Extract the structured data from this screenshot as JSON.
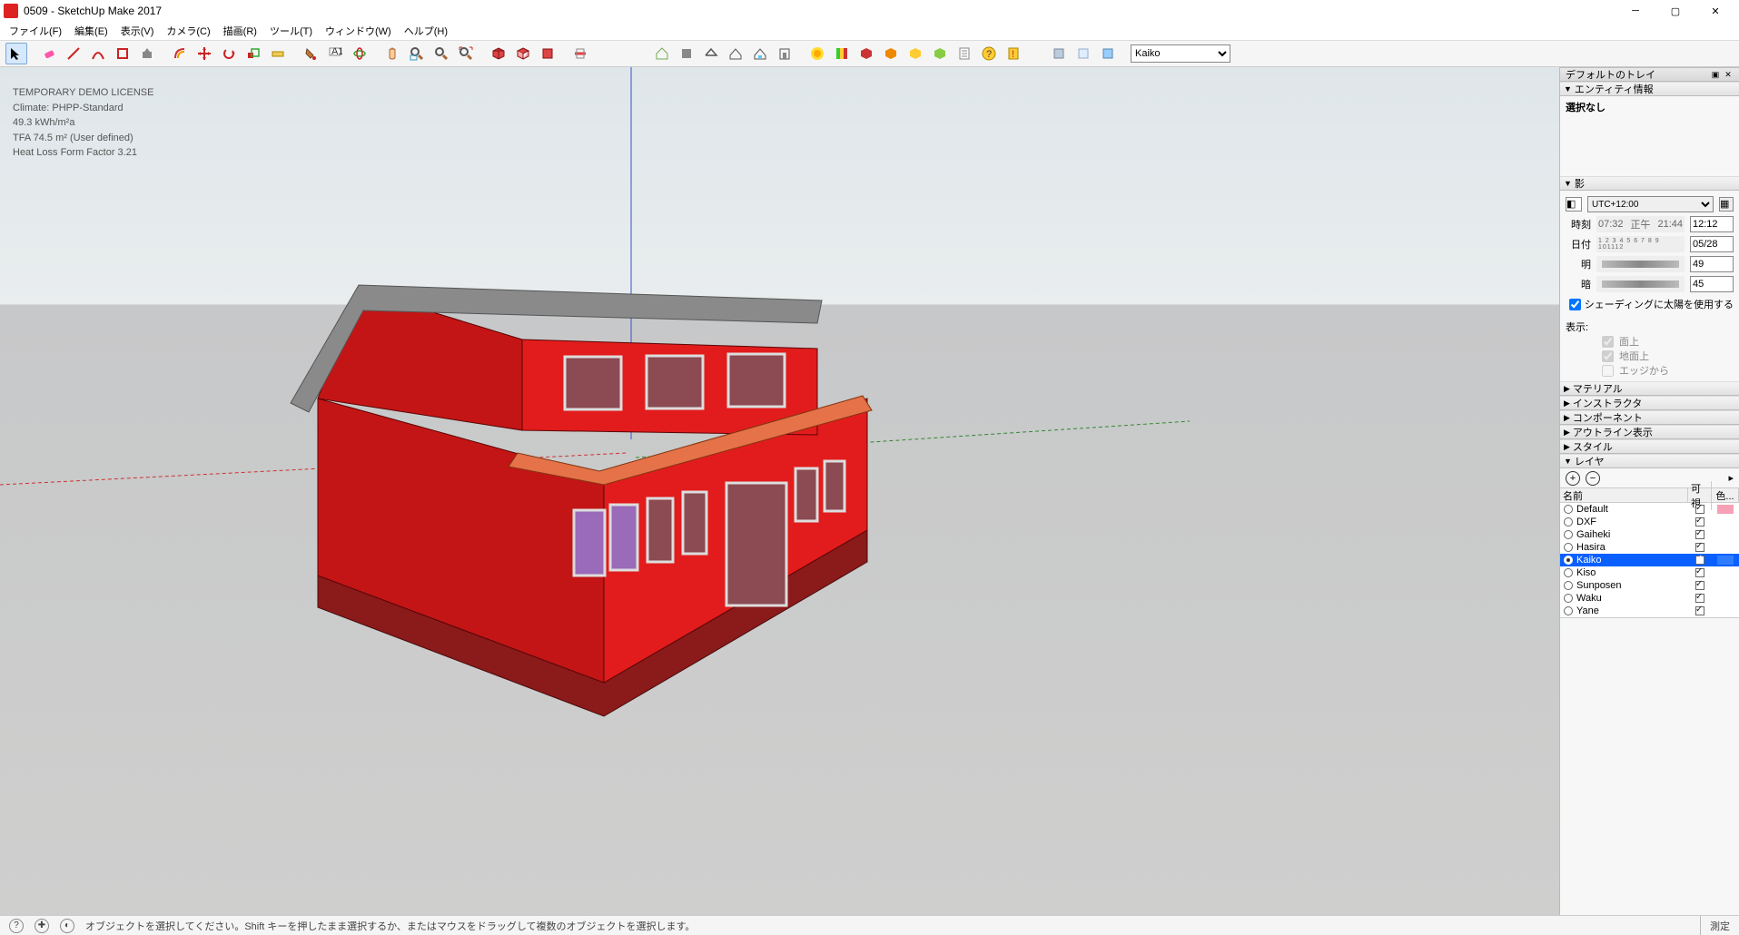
{
  "window": {
    "title": "0509 - SketchUp Make 2017"
  },
  "menu": [
    "ファイル(F)",
    "編集(E)",
    "表示(V)",
    "カメラ(C)",
    "描画(R)",
    "ツール(T)",
    "ウィンドウ(W)",
    "ヘルプ(H)"
  ],
  "scene_select": {
    "value": "Kaiko"
  },
  "overlay": {
    "line1": "TEMPORARY DEMO LICENSE",
    "line2": "Climate: PHPP-Standard",
    "line3": "49.3 kWh/m²a",
    "line4": "TFA  74.5 m² (User defined)",
    "line5": "Heat Loss Form Factor 3.21"
  },
  "tray": {
    "title": "デフォルトのトレイ",
    "entity": {
      "header": "エンティティ情報",
      "text": "選択なし"
    },
    "shadow": {
      "header": "影",
      "tz": "UTC+12:00",
      "time_label": "時刻",
      "time_start": "07:32",
      "time_mid": "正午",
      "time_end": "21:44",
      "time_value": "12:12",
      "date_label": "日付",
      "date_ticks": "1 2 3 4 5 6 7 8 9 101112",
      "date_value": "05/28",
      "light_label": "明",
      "light_value": "49",
      "dark_label": "暗",
      "dark_value": "45",
      "use_sun": "シェーディングに太陽を使用する",
      "display_label": "表示:",
      "opt_face": "面上",
      "opt_ground": "地面上",
      "opt_edge": "エッジから"
    },
    "collapsed": [
      "マテリアル",
      "インストラクタ",
      "コンポーネント",
      "アウトライン表示",
      "スタイル"
    ],
    "layers": {
      "header": "レイヤ",
      "cols": {
        "name": "名前",
        "vis": "可視",
        "color": "色..."
      },
      "items": [
        {
          "name": "Default",
          "vis": true,
          "active": false,
          "color": "#f7a0b6"
        },
        {
          "name": "DXF",
          "vis": true,
          "active": false,
          "color": ""
        },
        {
          "name": "Gaiheki",
          "vis": true,
          "active": false,
          "color": ""
        },
        {
          "name": "Hasira",
          "vis": true,
          "active": false,
          "color": ""
        },
        {
          "name": "Kaiko",
          "vis": true,
          "active": true,
          "color": "#2f7cff",
          "selected": true
        },
        {
          "name": "Kiso",
          "vis": true,
          "active": false,
          "color": ""
        },
        {
          "name": "Sunposen",
          "vis": true,
          "active": false,
          "color": ""
        },
        {
          "name": "Waku",
          "vis": true,
          "active": false,
          "color": ""
        },
        {
          "name": "Yane",
          "vis": true,
          "active": false,
          "color": ""
        }
      ]
    }
  },
  "statusbar": {
    "hint": "オブジェクトを選択してください。Shift キーを押したまま選択するか、またはマウスをドラッグして複数のオブジェクトを選択します。",
    "measure_label": "測定"
  }
}
